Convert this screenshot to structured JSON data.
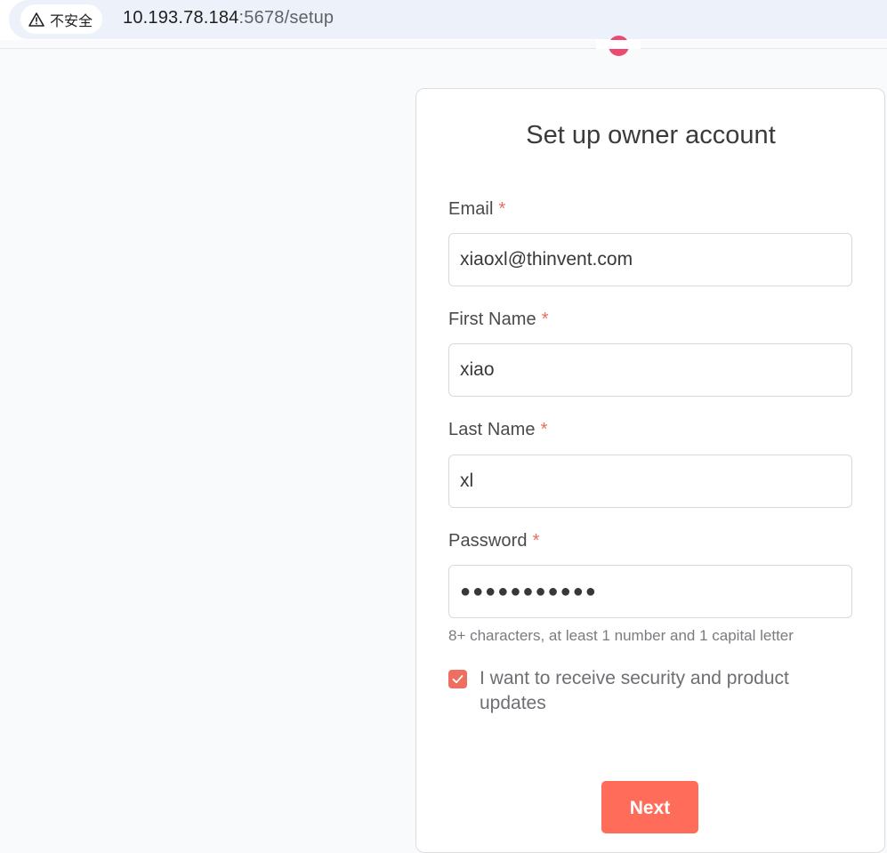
{
  "browser": {
    "security_label": "不安全",
    "url_host": "10.193.78.184",
    "url_path": ":5678/setup"
  },
  "form": {
    "title": "Set up owner account",
    "required_marker": "*",
    "email": {
      "label": "Email",
      "value": "xiaoxl@thinvent.com"
    },
    "first_name": {
      "label": "First Name",
      "value": "xiao"
    },
    "last_name": {
      "label": "Last Name",
      "value": "xl"
    },
    "password": {
      "label": "Password",
      "value": "●●●●●●●●●●●",
      "hint": "8+ characters, at least 1 number and 1 capital letter"
    },
    "updates_checkbox": {
      "checked": true,
      "label": "I want to receive security and product updates"
    },
    "next_label": "Next"
  },
  "colors": {
    "accent": "#ff6d5a",
    "required": "#ef6b5d",
    "logo": "#ea4b71"
  }
}
